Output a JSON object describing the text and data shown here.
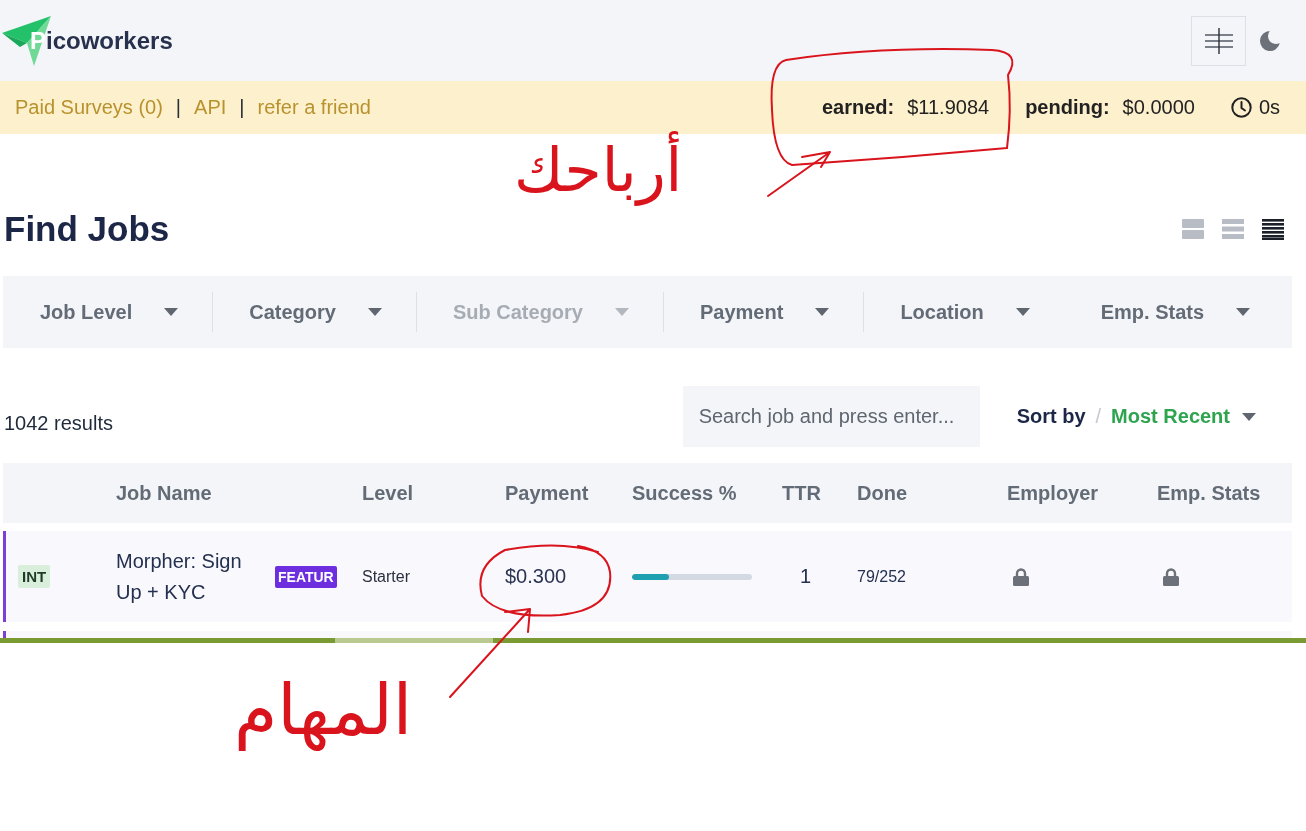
{
  "brand": "Picoworkers",
  "info_bar": {
    "items": [
      {
        "kind": "link",
        "text": "Paid Surveys (0)"
      },
      {
        "kind": "separator",
        "text": "|"
      },
      {
        "kind": "link",
        "text": "API"
      },
      {
        "kind": "separator",
        "text": "|"
      },
      {
        "kind": "link",
        "text": "refer a friend"
      }
    ],
    "stats": [
      {
        "label": "earned:",
        "value": "$11.9084"
      },
      {
        "label": "pending:",
        "value": "$0.0000"
      }
    ],
    "timer": "0s"
  },
  "title": "Find Jobs",
  "view_modes": [
    {
      "kind": "large",
      "selected": false
    },
    {
      "kind": "medium",
      "selected": false
    },
    {
      "kind": "compact",
      "selected": true
    }
  ],
  "filters": [
    {
      "label": "Job Level",
      "disabled": false
    },
    {
      "label": "Category",
      "disabled": false
    },
    {
      "label": "Sub Category",
      "disabled": true
    },
    {
      "label": "Payment",
      "disabled": false
    },
    {
      "label": "Location",
      "disabled": false
    },
    {
      "label": "Emp. Stats",
      "disabled": false
    }
  ],
  "results_count": "1042 results",
  "search": {
    "placeholder": "Search job and press enter..."
  },
  "sort": {
    "label": "Sort by",
    "separator": "/",
    "value": "Most Recent"
  },
  "table": {
    "columns": [
      "Job Name",
      "Level",
      "Payment",
      "Success %",
      "TTR",
      "Done",
      "Employer",
      "Emp. Stats"
    ],
    "rows": [
      {
        "featured": true,
        "type": "INT",
        "name": "Morpher: Sign Up + KYC",
        "badge": "FEATUR",
        "job_level": "Starter",
        "payment": "$0.300",
        "success": {
          "level": 0.31
        },
        "ttr": "1",
        "done": "79/252",
        "employer_locked": true,
        "emp_stats_locked": true
      }
    ]
  },
  "annotations": [
    {
      "text": "أرباحك"
    },
    {
      "text": "المهام"
    }
  ]
}
